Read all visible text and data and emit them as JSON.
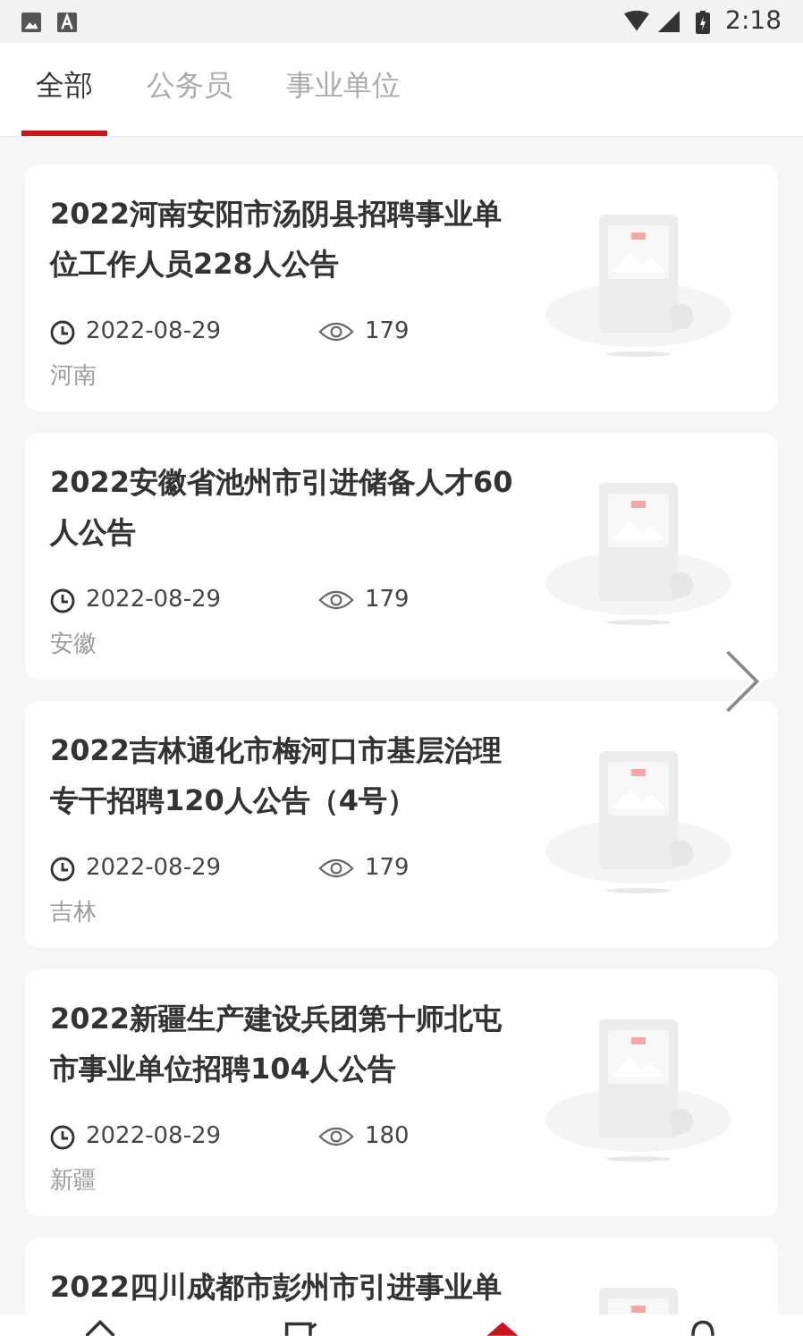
{
  "status_bar": {
    "time": "2:18"
  },
  "tabs": [
    {
      "label": "全部",
      "selected": true
    },
    {
      "label": "公务员",
      "selected": false
    },
    {
      "label": "事业单位",
      "selected": false
    }
  ],
  "articles": [
    {
      "title": "2022河南安阳市汤阴县招聘事业单位工作人员228人公告",
      "date": "2022-08-29",
      "views": "179",
      "region": "河南"
    },
    {
      "title": "2022安徽省池州市引进储备人才60人公告",
      "date": "2022-08-29",
      "views": "179",
      "region": "安徽"
    },
    {
      "title": "2022吉林通化市梅河口市基层治理专干招聘120人公告（4号）",
      "date": "2022-08-29",
      "views": "179",
      "region": "吉林"
    },
    {
      "title": "2022新疆生产建设兵团第十师北屯市事业单位招聘104人公告",
      "date": "2022-08-29",
      "views": "180",
      "region": "新疆"
    },
    {
      "title": "2022四川成都市彭州市引进事业单"
    }
  ],
  "bottom_nav": [
    {
      "selected": false
    },
    {
      "selected": false
    },
    {
      "selected": true
    },
    {
      "selected": false
    }
  ]
}
